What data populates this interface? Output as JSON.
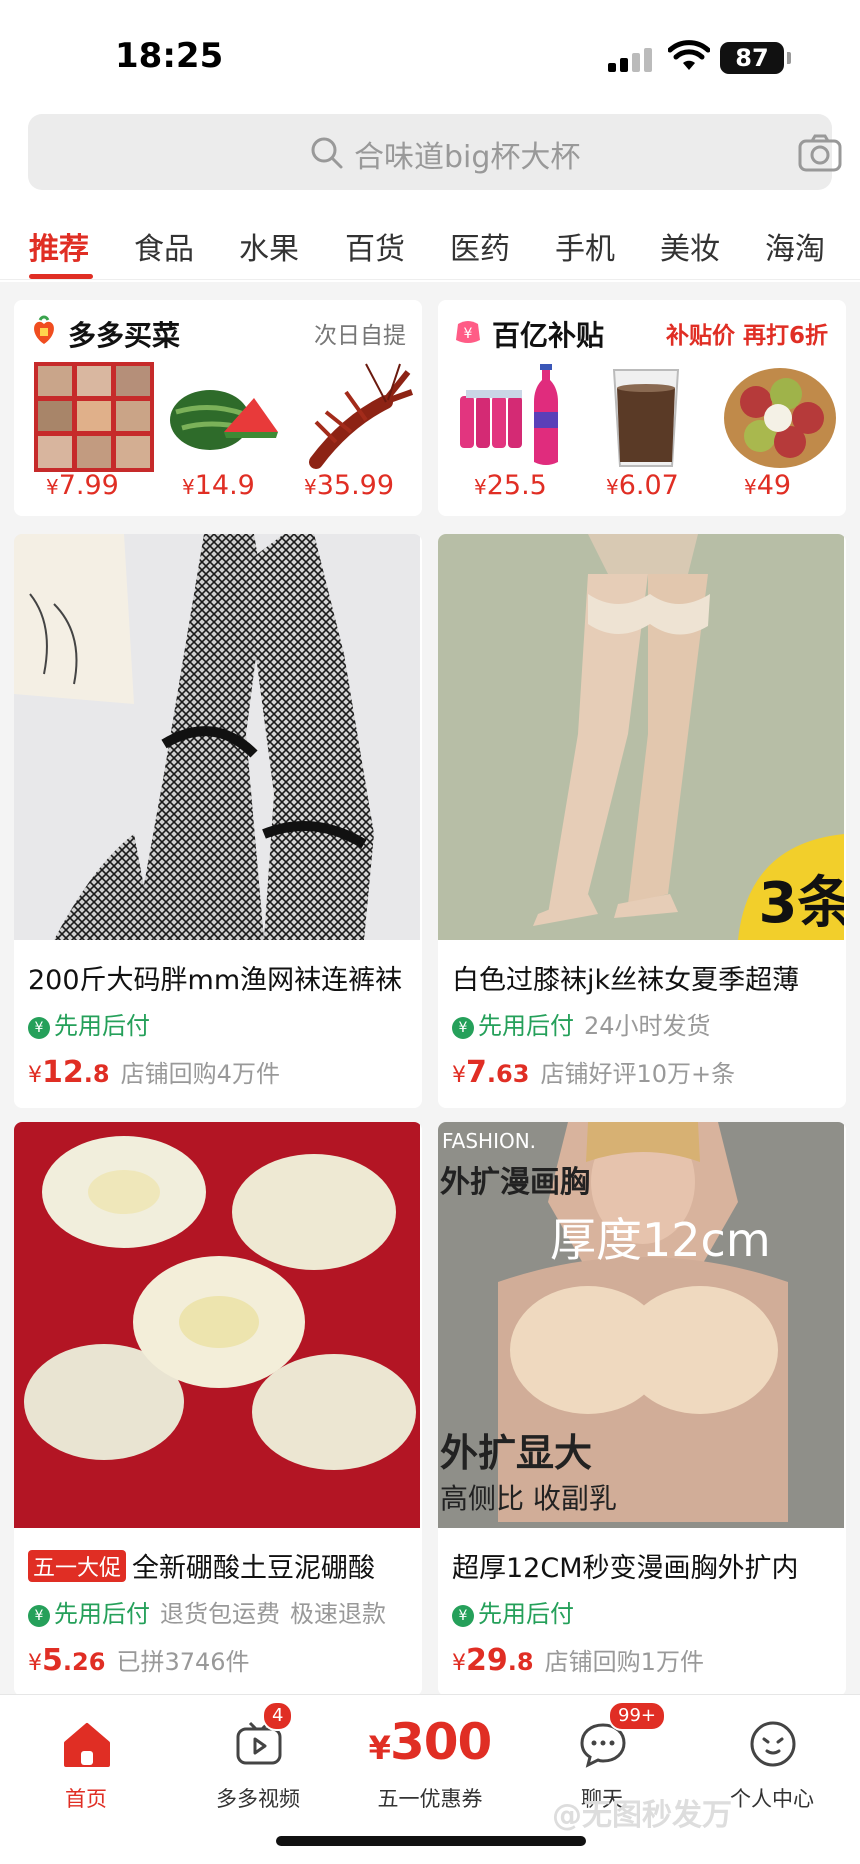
{
  "status_bar": {
    "time": "18:25",
    "battery": "87"
  },
  "search": {
    "placeholder": "合味道big杯大杯"
  },
  "tabs": [
    "推荐",
    "食品",
    "水果",
    "百货",
    "医药",
    "手机",
    "美妆",
    "海淘"
  ],
  "active_tab": "推荐",
  "promo_cards": [
    {
      "title": "多多买菜",
      "subtitle": "次日自提",
      "items": [
        {
          "image": "produce-tiles",
          "price": "7.99"
        },
        {
          "image": "watermelon",
          "price": "14.9"
        },
        {
          "image": "crayfish",
          "price": "35.99"
        }
      ]
    },
    {
      "title": "百亿补贴",
      "subtitle": "补贴价 再打6折",
      "items": [
        {
          "image": "soda-bottles",
          "price": "25.5"
        },
        {
          "image": "cola-cup",
          "price": "6.07"
        },
        {
          "image": "lychee-bowl",
          "price": "49"
        }
      ]
    }
  ],
  "products": [
    {
      "image": "fishnet-tights-photo",
      "title": "200斤大码胖mm渔网袜连裤袜",
      "promo_tag": "",
      "pay_tag": "先用后付",
      "extras": [],
      "price_int": "12",
      "price_dec": ".8",
      "sales": "店铺回购4万件"
    },
    {
      "image": "lace-stockings-photo",
      "title": "白色过膝袜jk丝袜女夏季超薄",
      "promo_tag": "",
      "pay_tag": "先用后付",
      "extras": [
        "24小时发货"
      ],
      "price_int": "7",
      "price_dec": ".63",
      "sales": "店铺好评10万+条",
      "overlay_text": "3条"
    },
    {
      "image": "round-soap-bars-photo",
      "title": "全新硼酸土豆泥硼酸",
      "promo_tag": "五一大促",
      "pay_tag": "先用后付",
      "extras": [
        "退货包运费",
        "极速退款"
      ],
      "price_int": "5",
      "price_dec": ".26",
      "sales": "已拼3746件"
    },
    {
      "image": "padded-bra-photo",
      "title": "超厚12CM秒变漫画胸外扩内",
      "promo_tag": "",
      "pay_tag": "先用后付",
      "extras": [],
      "price_int": "29",
      "price_dec": ".8",
      "sales": "店铺回购1万件",
      "overlay_lines": [
        "FASHION.",
        "外扩漫画胸",
        "厚度12cm",
        "外扩显大",
        "高侧比 收副乳"
      ]
    }
  ],
  "currency": "¥",
  "bottom_nav": [
    {
      "label": "首页",
      "icon": "home-icon",
      "badge": ""
    },
    {
      "label": "多多视频",
      "icon": "video-icon",
      "badge": "4"
    },
    {
      "label": "五一优惠券",
      "icon": "coupon",
      "amount": "300",
      "badge": ""
    },
    {
      "label": "聊天",
      "icon": "chat-icon",
      "badge": "99+"
    },
    {
      "label": "个人中心",
      "icon": "profile-icon",
      "badge": ""
    }
  ],
  "watermark": "@无图秒发万",
  "colors": {
    "accent": "#e02e24",
    "pay_green": "#25a05a"
  }
}
